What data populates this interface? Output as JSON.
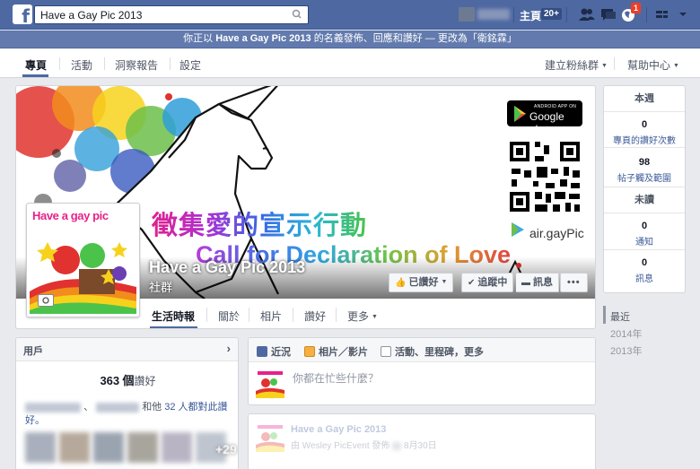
{
  "topbar": {
    "search_value": "Have a Gay Pic 2013",
    "home_label": "主頁",
    "home_count": "20+",
    "notification_count": "1"
  },
  "notice": {
    "prefix": "你正以",
    "page_name": "Have a Gay Pic 2013",
    "middle": "的名義發佈、回應和讚好 — 更改為「",
    "user_name": "衛銘霖",
    "suffix": "」"
  },
  "page_tabs": {
    "items": [
      "專頁",
      "活動",
      "洞察報告",
      "設定"
    ],
    "build_audience": "建立粉絲群",
    "help": "幫助中心"
  },
  "cover": {
    "gplay_small": "ANDROID APP ON",
    "gplay_big": "Google play",
    "air_label": "air.gayPic",
    "slogan_zh": "徵集愛的宣示行動",
    "slogan_en": "Call for Declaration of Love",
    "profile_title": "Have a gay pic"
  },
  "page": {
    "name": "Have a Gay Pic 2013",
    "category": "社群"
  },
  "actions": {
    "liked": "已讚好",
    "following": "追蹤中",
    "message": "訊息",
    "more": "•••"
  },
  "cover_tabs": [
    "生活時報",
    "關於",
    "相片",
    "讚好",
    "更多"
  ],
  "stats": {
    "this_week": "本週",
    "page_likes_value": "0",
    "page_likes_label": "專頁的讚好次數",
    "post_reach_value": "98",
    "post_reach_label": "帖子觸及範圍",
    "unread": "未讀",
    "notifications_value": "0",
    "notifications_label": "通知",
    "messages_value": "0",
    "messages_label": "訊息"
  },
  "timeline_nav": [
    "最近",
    "2014年",
    "2013年"
  ],
  "people": {
    "title": "用戶",
    "likes_count": "363",
    "likes_unit": "個",
    "likes_label": "讚好",
    "friends_sep": "、",
    "friends_and": "和他",
    "friends_others": "32 人都對此讚好。",
    "plus_more": "+29"
  },
  "composer": {
    "status": "近況",
    "photo": "相片／影片",
    "event": "活動、里程碑，更多",
    "placeholder": "你都在忙些什麼？"
  },
  "post": {
    "name": "Have a Gay Pic 2013",
    "meta_prefix": "由",
    "meta_by": "Wesley PicEvent 發佈",
    "meta_date": "8月30日"
  }
}
